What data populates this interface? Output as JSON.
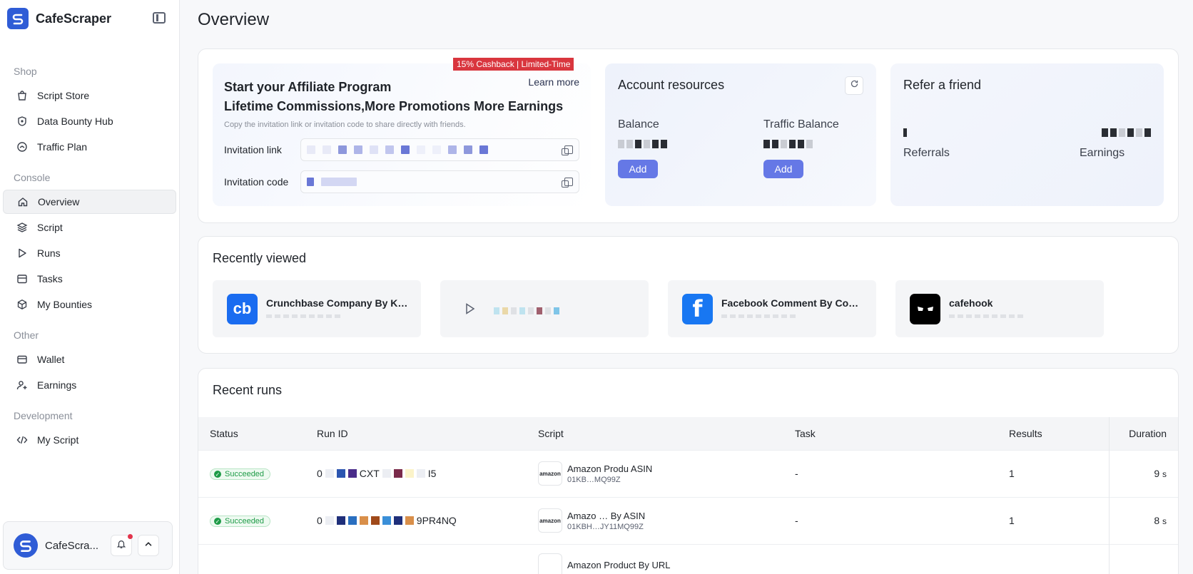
{
  "brand": {
    "name": "CafeScraper"
  },
  "sidebar": {
    "sections": {
      "shop": "Shop",
      "console": "Console",
      "other": "Other",
      "development": "Development"
    },
    "items": {
      "script_store": "Script Store",
      "data_bounty_hub": "Data Bounty Hub",
      "traffic_plan": "Traffic Plan",
      "overview": "Overview",
      "script": "Script",
      "runs": "Runs",
      "tasks": "Tasks",
      "my_bounties": "My Bounties",
      "wallet": "Wallet",
      "earnings": "Earnings",
      "my_script": "My Script"
    },
    "user": {
      "name": "CafeScra..."
    }
  },
  "page": {
    "title": "Overview"
  },
  "affiliate": {
    "promo": "15% Cashback | Limited-Time",
    "learn_more": "Learn more",
    "title_line1": "Start your Affiliate Program",
    "title_line2": "Lifetime Commissions,More Promotions More Earnings",
    "subtitle": "Copy the invitation link or invitation code to share directly with friends.",
    "invitation_link_label": "Invitation link",
    "invitation_code_label": "Invitation code"
  },
  "resources": {
    "title": "Account resources",
    "balance_label": "Balance",
    "traffic_label": "Traffic Balance",
    "add_label": "Add"
  },
  "refer": {
    "title": "Refer a friend",
    "referrals_label": "Referrals",
    "earnings_label": "Earnings"
  },
  "recently_viewed": {
    "title": "Recently viewed",
    "items": [
      {
        "name": "Crunchbase Company By Key...",
        "logo": "cb"
      },
      {
        "name": "",
        "logo": "play-icon"
      },
      {
        "name": "Facebook Comment By Comm...",
        "logo": "f"
      },
      {
        "name": "cafehook",
        "logo": "cafehook-logo"
      }
    ]
  },
  "recent_runs": {
    "title": "Recent runs",
    "columns": [
      "Status",
      "Run ID",
      "Script",
      "Task",
      "Results",
      "Duration"
    ],
    "rows": [
      {
        "status": "Succeeded",
        "run_id_prefix": "0",
        "run_id_mid": "CXT",
        "run_id_suffix": "I5",
        "script_name": "Amazon Produ",
        "script_name_end": "ASIN",
        "script_id": "01KB",
        "script_id_end": "MQ99Z",
        "task": "-",
        "results": "1",
        "duration": "9",
        "duration_unit": "s"
      },
      {
        "status": "Succeeded",
        "run_id_prefix": "0",
        "run_id_mid": "",
        "run_id_suffix": "9PR4NQ",
        "script_name": "Amazo",
        "script_name_end": "By ASIN",
        "script_id": "01KBH",
        "script_id_end": "JY11MQ99Z",
        "task": "-",
        "results": "1",
        "duration": "8",
        "duration_unit": "s"
      },
      {
        "status": "",
        "run_id_prefix": "",
        "run_id_mid": "",
        "run_id_suffix": "",
        "script_name": "Amazon Product By URL",
        "script_name_end": "",
        "script_id": "",
        "script_id_end": "",
        "task": "",
        "results": "",
        "duration": "",
        "duration_unit": ""
      }
    ]
  },
  "colors": {
    "accent": "#2f5cd6",
    "add_button": "#6578e6",
    "promo": "#d9363e",
    "success": "#1e9b47"
  }
}
